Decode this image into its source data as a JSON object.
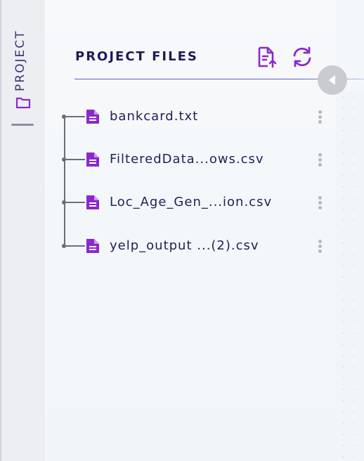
{
  "sidebar": {
    "tab_label": "PROJECT",
    "tab_icon": "folder-icon"
  },
  "panel": {
    "title": "PROJECT FILES",
    "upload_icon": "file-upload-icon",
    "refresh_icon": "refresh-icon",
    "collapse_icon": "chevron-left-icon"
  },
  "files": [
    {
      "name": "bankcard.txt",
      "icon": "file-icon",
      "menu_icon": "more-vertical-icon"
    },
    {
      "name": "FilteredData...ows.csv",
      "icon": "file-icon",
      "menu_icon": "more-vertical-icon"
    },
    {
      "name": "Loc_Age_Gen_...ion.csv",
      "icon": "file-icon",
      "menu_icon": "more-vertical-icon"
    },
    {
      "name": "yelp_output ...(2).csv",
      "icon": "file-icon",
      "menu_icon": "more-vertical-icon"
    }
  ],
  "colors": {
    "accent": "#8b28cc",
    "title": "#221a57",
    "file_text": "#23205a",
    "tree_line": "#6b6f78"
  }
}
